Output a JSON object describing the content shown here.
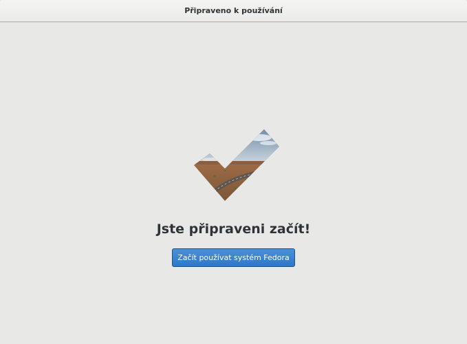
{
  "window": {
    "title": "Připraveno k používání"
  },
  "main": {
    "hero_image": "checkmark-landscape-icon",
    "headline": "Jste připraveni začít!",
    "start_button_label": "Začít používat systém Fedora"
  },
  "colors": {
    "background": "#e8e8e7",
    "accent": "#3584e4",
    "text": "#2e3436"
  }
}
